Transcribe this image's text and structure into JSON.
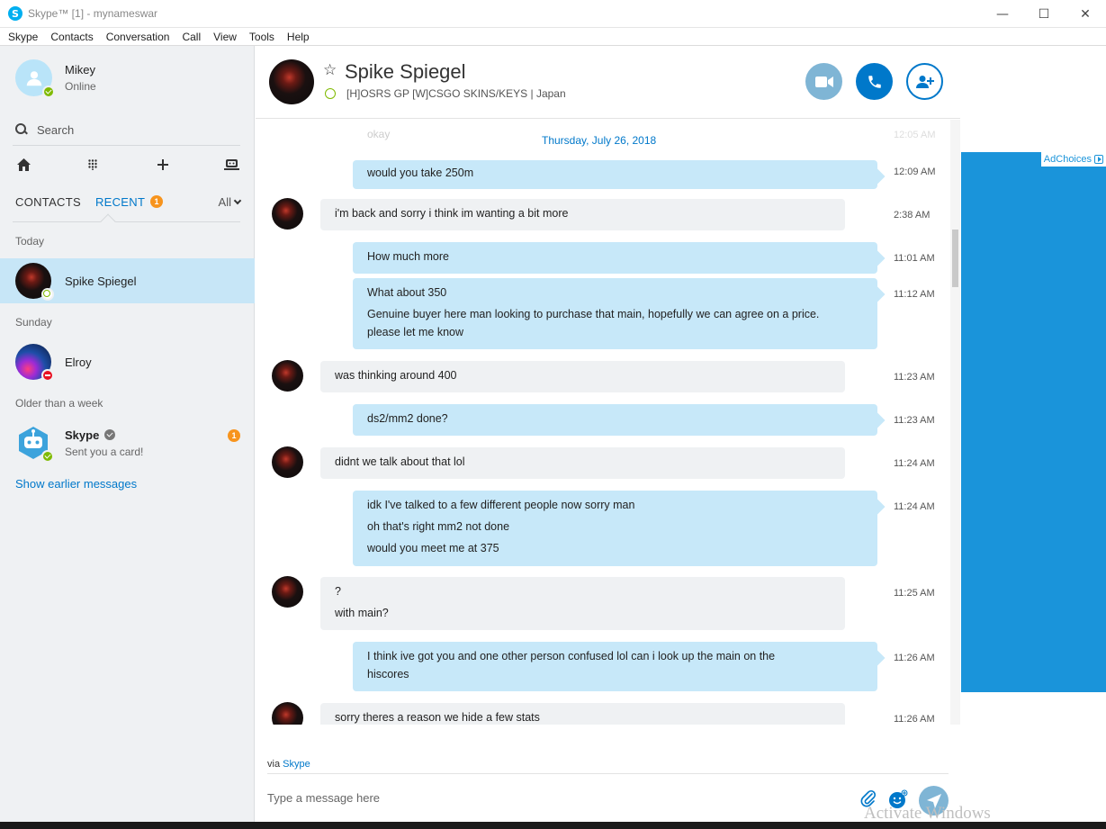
{
  "window": {
    "title": "Skype™ [1] - mynameswar",
    "app_icon": "skype-logo-icon",
    "minimize": "—",
    "maximize": "☐",
    "close": "✕"
  },
  "menu": [
    "Skype",
    "Contacts",
    "Conversation",
    "Call",
    "View",
    "Tools",
    "Help"
  ],
  "profile": {
    "name": "Mikey",
    "status": "Online"
  },
  "search": {
    "label": "Search"
  },
  "tabs": {
    "contacts": "CONTACTS",
    "recent": "RECENT",
    "recent_badge": "1",
    "filter": "All"
  },
  "groups": {
    "today": "Today",
    "sunday": "Sunday",
    "older": "Older than a week"
  },
  "contacts": [
    {
      "name": "Spike Spiegel",
      "status": "online-away"
    },
    {
      "name": "Elroy",
      "status": "do-not-disturb"
    },
    {
      "name": "Skype",
      "sub": "Sent you a card!",
      "badge": "1",
      "verified": true
    }
  ],
  "show_earlier": "Show earlier messages",
  "conversation": {
    "name": "Spike Spiegel",
    "mood": "[H]OSRS GP [W]CSGO SKINS/KEYS | Japan",
    "date": "Thursday, July 26, 2018",
    "faded_text": "okay",
    "faded_time": "12:05 AM"
  },
  "messages": [
    {
      "dir": "out",
      "lines": [
        "would you take 250m"
      ],
      "time": "12:09 AM"
    },
    {
      "dir": "in",
      "lines": [
        "i'm back and sorry i think im wanting a bit more"
      ],
      "time": "2:38 AM"
    },
    {
      "dir": "out",
      "lines": [
        "How much more"
      ],
      "time": "11:01 AM"
    },
    {
      "dir": "out",
      "lines": [
        "What about 350",
        "Genuine buyer here man looking to purchase that main, hopefully we can agree on a price. please let me know"
      ],
      "time": "11:12 AM"
    },
    {
      "dir": "in",
      "lines": [
        "was thinking around 400"
      ],
      "time": "11:23 AM"
    },
    {
      "dir": "out",
      "lines": [
        "ds2/mm2 done?"
      ],
      "time": "11:23 AM"
    },
    {
      "dir": "in",
      "lines": [
        "didnt we talk about that lol"
      ],
      "time": "11:24 AM"
    },
    {
      "dir": "out",
      "lines": [
        "idk I've talked to a few different people now sorry man",
        "oh that's right mm2 not done",
        "would you meet me at 375"
      ],
      "time": "11:24 AM"
    },
    {
      "dir": "in",
      "lines": [
        "?",
        "with main?"
      ],
      "time": "11:25 AM"
    },
    {
      "dir": "out",
      "lines": [
        "I think ive got you and one other person confused lol can i look up the main on the hiscores"
      ],
      "time": "11:26 AM"
    },
    {
      "dir": "in",
      "lines": [
        "sorry theres a reason we hide a few stats"
      ],
      "time": "11:26 AM"
    }
  ],
  "composer": {
    "via_prefix": "via",
    "via_link": "Skype",
    "placeholder": "Type a message here"
  },
  "ad": {
    "choices": "AdChoices",
    "bg_color": "#1a94da"
  },
  "watermark": "Activate Windows",
  "colors": {
    "accent": "#0078ca",
    "selected": "#c7e6f7",
    "outgoing": "#c7e8f9",
    "incoming": "#eff1f3",
    "badge": "#f7941d"
  }
}
